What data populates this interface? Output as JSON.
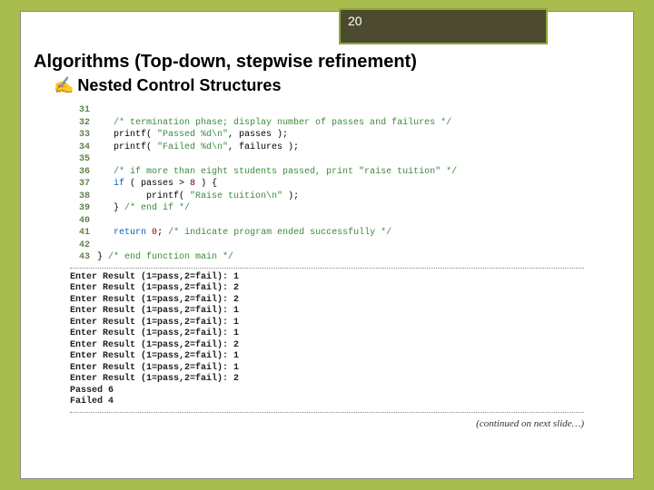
{
  "slide_number": "20",
  "title": "Algorithms (Top-down, stepwise refinement)",
  "subtitle": "Nested Control Structures",
  "code": {
    "lines": [
      {
        "n": "31",
        "cm": "",
        "txt": ""
      },
      {
        "n": "32",
        "cm": "/* termination phase; display number of passes and failures */",
        "txt": ""
      },
      {
        "n": "33",
        "txt": "printf( \"Passed %d\\n\", passes );"
      },
      {
        "n": "34",
        "txt": "printf( \"Failed %d\\n\", failures );"
      },
      {
        "n": "35",
        "txt": ""
      },
      {
        "n": "36",
        "cm": "/* if more than eight students passed, print \"raise tuition\" */",
        "txt": ""
      },
      {
        "n": "37",
        "txt": "if ( passes > 8 ) {"
      },
      {
        "n": "38",
        "txt": "   printf( \"Raise tuition\\n\" );"
      },
      {
        "n": "39",
        "txt": "} /* end if */"
      },
      {
        "n": "40",
        "txt": ""
      },
      {
        "n": "41",
        "txt": "return 0; /* indicate program ended successfully */"
      },
      {
        "n": "42",
        "txt": ""
      },
      {
        "n": "43",
        "txt": "} /* end function main */"
      }
    ]
  },
  "output": {
    "prompt": "Enter Result (1=pass,2=fail): ",
    "results": [
      "1",
      "2",
      "2",
      "1",
      "1",
      "1",
      "2",
      "1",
      "1",
      "2"
    ],
    "passed_label": "Passed 6",
    "failed_label": "Failed 4"
  },
  "continued": "(continued on next slide…)"
}
